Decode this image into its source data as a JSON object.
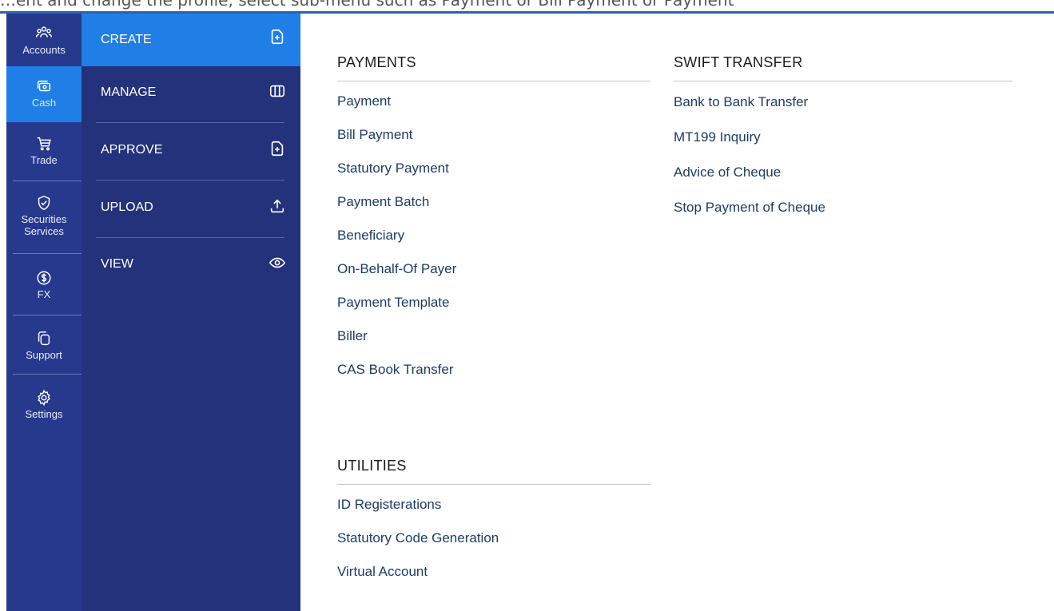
{
  "topbar": {
    "text": "…ent and change the profile, select sub-menu such as Payment or Bill Payment or Payment"
  },
  "rail": {
    "items": [
      {
        "label": "Accounts",
        "icon": "users-group-icon"
      },
      {
        "label": "Cash",
        "icon": "cash-icon"
      },
      {
        "label": "Trade",
        "icon": "cart-icon"
      },
      {
        "label": "Securities Services",
        "icon": "shield-icon"
      },
      {
        "label": "FX",
        "icon": "dollar-circle-icon"
      },
      {
        "label": "Support",
        "icon": "copy-icon"
      },
      {
        "label": "Settings",
        "icon": "gear-icon"
      }
    ],
    "active": "Cash"
  },
  "submenu": {
    "items": [
      {
        "label": "CREATE",
        "icon": "add-file-icon"
      },
      {
        "label": "MANAGE",
        "icon": "columns-icon"
      },
      {
        "label": "APPROVE",
        "icon": "add-file-icon"
      },
      {
        "label": "UPLOAD",
        "icon": "upload-icon"
      },
      {
        "label": "VIEW",
        "icon": "eye-icon"
      }
    ],
    "active": "CREATE"
  },
  "payments": {
    "title": "PAYMENTS",
    "links": [
      "Payment",
      "Bill Payment",
      "Statutory Payment",
      "Payment Batch",
      "Beneficiary",
      "On-Behalf-Of Payer",
      "Payment Template",
      "Biller",
      "CAS Book Transfer"
    ]
  },
  "utilities": {
    "title": "UTILITIES",
    "links": [
      "ID Registerations",
      "Statutory Code Generation",
      "Virtual Account"
    ]
  },
  "swift": {
    "title": "SWIFT TRANSFER",
    "links": [
      "Bank to Bank Transfer",
      "MT199 Inquiry",
      "Advice of Cheque",
      "Stop Payment of Cheque"
    ]
  },
  "colors": {
    "rail": "#26398d",
    "submenu": "#23327a",
    "active": "#1f7fe6",
    "link": "#1d3b66"
  }
}
